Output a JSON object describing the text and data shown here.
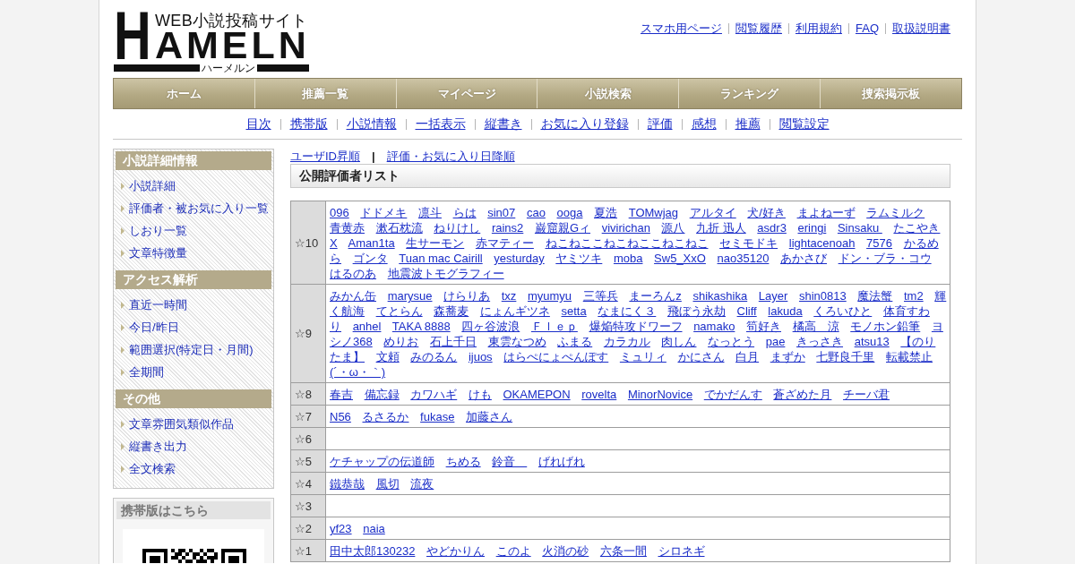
{
  "header": {
    "logo": {
      "initial": "H",
      "wordmark": "AMELN",
      "tagline": "WEB小説投稿サイト",
      "kana": "ハーメルン"
    },
    "links": [
      "スマホ用ページ",
      "閲覧履歴",
      "利用規約",
      "FAQ",
      "取扱説明書"
    ]
  },
  "nav": [
    "ホーム",
    "推薦一覧",
    "マイページ",
    "小説検索",
    "ランキング",
    "捜索掲示板"
  ],
  "sub_nav": [
    "目次",
    "携帯版",
    "小説情報",
    "一括表示",
    "縦書き",
    "お気に入り登録",
    "評価",
    "感想",
    "推薦",
    "閲覧設定"
  ],
  "sidebar": {
    "sections": [
      {
        "title": "小説詳細情報",
        "items": [
          "小説詳細",
          "評価者・被お気に入り一覧",
          "しおり一覧",
          "文章特徴量"
        ]
      },
      {
        "title": "アクセス解析",
        "items": [
          "直近一時間",
          "今日/昨日",
          "範囲選択(特定日・月間)",
          "全期間"
        ]
      },
      {
        "title": "その他",
        "items": [
          "文章雰囲気類似作品",
          "縦書き出力",
          "全文検索"
        ]
      }
    ],
    "mobile": {
      "title": "携帯版はこちら"
    }
  },
  "main": {
    "sort_links": [
      "ユーザID昇順",
      "評価・お気に入り日降順"
    ],
    "sort_separator": "|",
    "title": "公開評価者リスト",
    "ratings": [
      {
        "rating": "☆10",
        "lines": [
          [
            "096",
            "ドドメキ",
            "凛斗",
            "らは",
            "sin07",
            "cao",
            "ooga",
            "夏浩",
            "TOMwjag",
            "アルタイ",
            "犬/好き",
            "まよねーず",
            "ラムミルク"
          ],
          [
            "青黄赤",
            "漱石枕流",
            "ねりけし",
            "rains2",
            "巌窟親Gィ",
            "vivirichan",
            "源八",
            "九折 迅人",
            "asdr3",
            "eringi",
            "Sinsaku ",
            "たこやき"
          ],
          [
            "X",
            "Aman1ta",
            "生サーモン",
            "赤マティー",
            "ねこねここねこねここねこねこ",
            "セミモドキ",
            "lightacenoah",
            "7576",
            "かるめ"
          ],
          [
            "ら",
            "ゴンタ",
            "Tuan mac Cairill",
            "yesturday",
            "ヤミツキ",
            "moba",
            "Sw5_XxO",
            "nao35120",
            "あかさび",
            "ドン・ブラ・コウ"
          ],
          [
            "はるのあ",
            "地震波トモグラフィー"
          ]
        ]
      },
      {
        "rating": "☆9",
        "lines": [
          [
            "みかん缶",
            "marysue",
            "けらりあ",
            "txz",
            "myumyu",
            "三等兵",
            "まーろんz",
            "shikashika",
            "Layer",
            "shin0813",
            "魔法蟹",
            "tm2",
            "輝"
          ],
          [
            "く航海",
            "てとらん",
            "森蕎麦",
            "にょんギツネ",
            "setta",
            "なまにく３",
            "飛ぼう永劫",
            "Cliff",
            "lakuda",
            "くろいひと",
            "体育すわ"
          ],
          [
            "り",
            "anhel",
            "TAKA 8888",
            "四ヶ谷波浪",
            "Ｆｌｅｐ",
            "爆焔特攻ドワーフ",
            "namako",
            "筍好き",
            "橘高　涼",
            "モノホン鉛筆",
            "ヨ"
          ],
          [
            "シノ368",
            "めりお",
            "石上千日",
            "東雲なつめ",
            "ふまる",
            "カラカル",
            "肉しん",
            "なっとう",
            "pae",
            "きっさき",
            "atsu13",
            "【のり"
          ],
          [
            "たま】",
            "文頼",
            "みのるん",
            "ijuos",
            "はらぺにょぺんぽす",
            "ミュリィ",
            "かにさん",
            "白月",
            "まずか",
            "七野良千里",
            "転載禁止"
          ],
          [
            "(´・ω・｀)"
          ]
        ]
      },
      {
        "rating": "☆8",
        "lines": [
          [
            "春吉",
            "備忘録",
            "カワハギ",
            "けも",
            "OKAMEPON",
            "rovelta",
            "MinorNovice",
            "でかだんす",
            "蒼ざめた月",
            "チーバ君"
          ]
        ]
      },
      {
        "rating": "☆7",
        "lines": [
          [
            "N56",
            "るさるか",
            "fukase",
            "加藤さん"
          ]
        ]
      },
      {
        "rating": "☆6"
      },
      {
        "rating": "☆5",
        "lines": [
          [
            "ケチャップの伝道師",
            "ちめる",
            "鈴音　",
            "げれげれ"
          ]
        ]
      },
      {
        "rating": "☆4",
        "lines": [
          [
            "鐵恭哉",
            "風切",
            "流夜"
          ]
        ]
      },
      {
        "rating": "☆3"
      },
      {
        "rating": "☆2",
        "lines": [
          [
            "yf23",
            "naia"
          ]
        ]
      },
      {
        "rating": "☆1",
        "lines": [
          [
            "田中太郎130232",
            "やどかりん",
            "このよ",
            "火消の砂",
            "六条一間",
            "シロネギ"
          ]
        ]
      }
    ]
  }
}
